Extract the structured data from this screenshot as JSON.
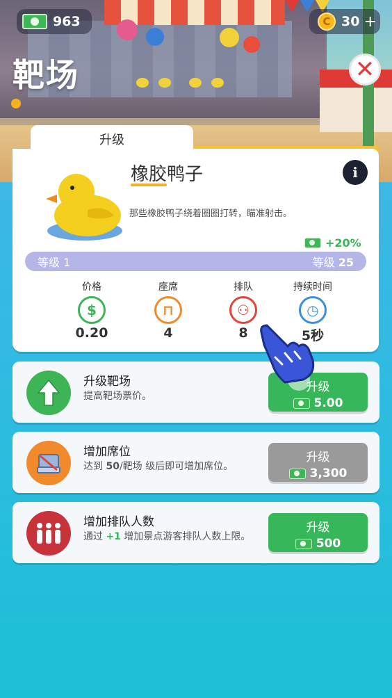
{
  "topbar": {
    "cash": "963",
    "coins": "30",
    "coin_add": "+",
    "coin_glyph": "C"
  },
  "page": {
    "title": "靶场",
    "close_glyph": "✕"
  },
  "tab": {
    "label": "升级"
  },
  "item": {
    "name": "橡胶鸭子",
    "description": "那些橡胶鸭子绕着圈圈打转，瞄准射击。",
    "bonus": "+20%",
    "info_glyph": "i",
    "level_from": "等级 1",
    "level_to_label": "等级",
    "level_to_value": "25"
  },
  "stats": [
    {
      "label": "价格",
      "value": "0.20",
      "icon": "dollar-icon",
      "color": "#3db455",
      "glyph": "$"
    },
    {
      "label": "座席",
      "value": "4",
      "icon": "seat-icon",
      "color": "#f08a2b",
      "glyph": "⊓"
    },
    {
      "label": "排队",
      "value": "8",
      "icon": "queue-icon",
      "color": "#e0453a",
      "glyph": "⚇"
    },
    {
      "label": "持续时间",
      "value": "5秒",
      "icon": "clock-icon",
      "color": "#3a8fe0",
      "glyph": "◷"
    }
  ],
  "rows": [
    {
      "title": "升级靶场",
      "desc": "提高靶场票价。",
      "button": {
        "label": "升级",
        "cost": "5.00"
      }
    },
    {
      "title": "增加席位",
      "desc_prefix": "达到 ",
      "desc_highlight": "50",
      "desc_suffix": "/靶场 级后即可增加席位。",
      "button": {
        "label": "升级",
        "cost": "3,300"
      }
    },
    {
      "title": "增加排队人数",
      "desc_prefix": "通过 ",
      "desc_highlight": "+1",
      "desc_suffix": " 增加景点游客排队人数上限。",
      "button": {
        "label": "升级",
        "cost": "500"
      }
    }
  ],
  "colors": {
    "accent_green": "#36b85a",
    "tab_yellow": "#f4c23b",
    "level_bar": "#b3b6e6"
  }
}
